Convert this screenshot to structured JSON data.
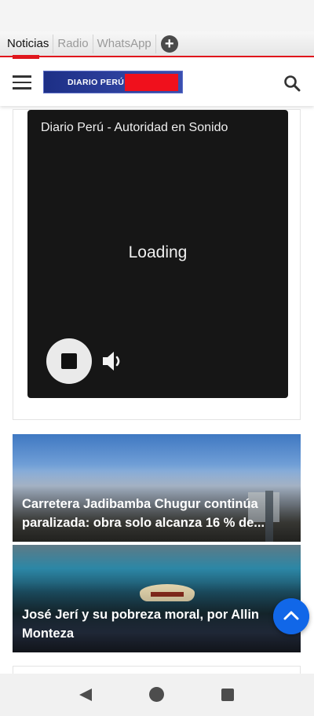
{
  "browser_tabs": [
    {
      "label": "Noticias",
      "active": true
    },
    {
      "label": "Radio",
      "active": false
    },
    {
      "label": "WhatsApp",
      "active": false
    }
  ],
  "add_tab_icon": "plus-circle-icon",
  "header": {
    "menu_icon": "hamburger-menu-icon",
    "logo_text": "DIARIO PERÚ",
    "search_icon": "search-icon"
  },
  "player": {
    "title": "Diario Perú - Autoridad en Sonido",
    "status": "Loading",
    "stop_icon": "stop-icon",
    "volume_icon": "volume-icon"
  },
  "news": [
    {
      "title": "Carretera Jadibamba Chugur continúa paralizada: obra solo alcanza 16 % de..."
    },
    {
      "title": "José Jerí y su pobreza moral, por Allin Monteza"
    }
  ],
  "scroll_top_icon": "chevron-up-icon",
  "colors": {
    "accent_red": "#e0161c",
    "logo_blue": "#1d2f86",
    "fab_blue": "#1167e8",
    "player_bg": "#161616"
  },
  "system_nav": {
    "back_icon": "back-triangle-icon",
    "home_icon": "home-circle-icon",
    "recents_icon": "recents-square-icon"
  }
}
